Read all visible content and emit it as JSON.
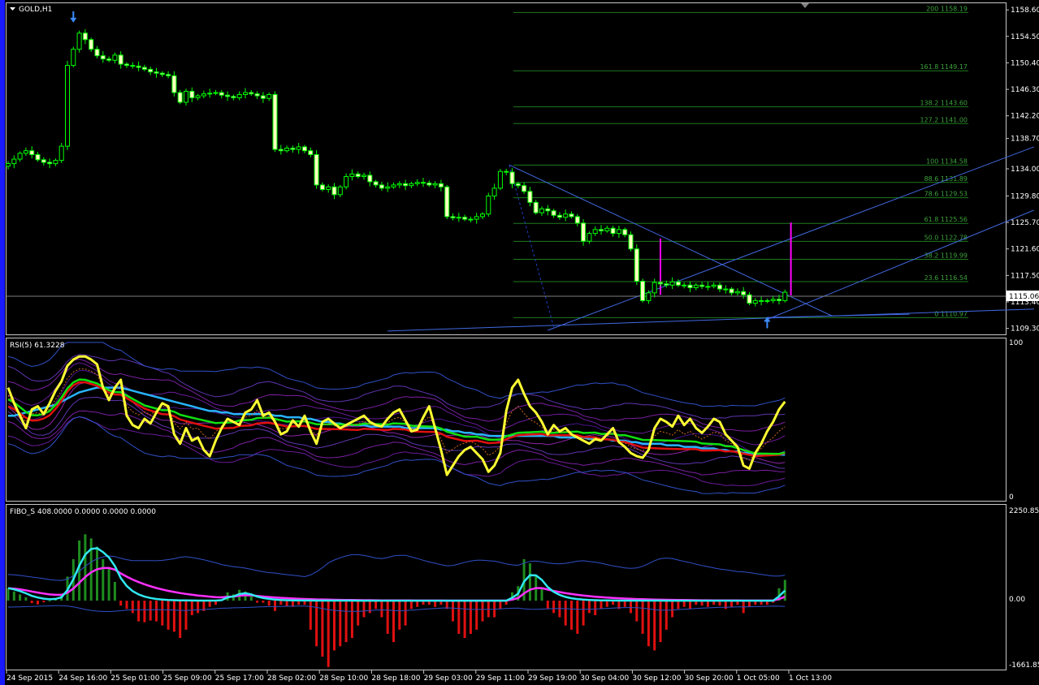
{
  "main": {
    "title": "GOLD,H1",
    "price_axis": [
      "1158.60",
      "1154.50",
      "1150.40",
      "1146.30",
      "1142.20",
      "1138.70",
      "1134.00",
      "1129.80",
      "1125.70",
      "1121.60",
      "1117.50",
      "1113.40",
      "1109.30"
    ],
    "current_price": "1115.06",
    "fib_levels": [
      {
        "label": "200 1158.19",
        "price": 1158.19
      },
      {
        "label": "161.8 1149.17",
        "price": 1149.17
      },
      {
        "label": "138.2 1143.60",
        "price": 1143.6
      },
      {
        "label": "127.2 1141.00",
        "price": 1141.0
      },
      {
        "label": "100 1134.58",
        "price": 1134.58
      },
      {
        "label": "88.6 1131.89",
        "price": 1131.89
      },
      {
        "label": "78.6 1129.53",
        "price": 1129.53
      },
      {
        "label": "61.8 1125.56",
        "price": 1125.56
      },
      {
        "label": "50.0 1122.78",
        "price": 1122.78
      },
      {
        "label": "38.2 1119.99",
        "price": 1119.99
      },
      {
        "label": "23.6 1116.54",
        "price": 1116.54
      },
      {
        "label": "0 1110.97",
        "price": 1110.97
      }
    ]
  },
  "rsi": {
    "title": "RSI(5) 61.3228",
    "axis": [
      "100",
      "0"
    ]
  },
  "fibo": {
    "title": "FIBO_S 408.0000 0.0000 0.0000 0.0000",
    "axis": [
      "2250.85",
      "0.00",
      "-1661.85"
    ]
  },
  "time_axis": [
    "24 Sep 2015",
    "24 Sep 16:00",
    "25 Sep 01:00",
    "25 Sep 09:00",
    "25 Sep 17:00",
    "28 Sep 02:00",
    "28 Sep 10:00",
    "28 Sep 18:00",
    "29 Sep 03:00",
    "29 Sep 11:00",
    "29 Sep 19:00",
    "30 Sep 04:00",
    "30 Sep 12:00",
    "30 Sep 20:00",
    "1 Oct 05:00",
    "1 Oct 13:00"
  ],
  "chart_data": [
    {
      "type": "candlestick",
      "title": "GOLD,H1",
      "ylim": [
        1108.5,
        1159.5
      ],
      "bars": 132,
      "close_approx": [
        1134.8,
        1135.5,
        1136.4,
        1136.8,
        1136.2,
        1135.4,
        1135.0,
        1134.8,
        1135.3,
        1137.5,
        1150.0,
        1152.5,
        1155.0,
        1154.0,
        1152.5,
        1151.5,
        1151.0,
        1150.8,
        1151.6,
        1150.2,
        1150.0,
        1149.9,
        1149.7,
        1149.4,
        1149.0,
        1148.8,
        1148.6,
        1148.4,
        1145.8,
        1144.3,
        1146.0,
        1145.0,
        1145.3,
        1145.6,
        1145.7,
        1145.8,
        1145.4,
        1145.2,
        1145.0,
        1145.5,
        1145.8,
        1145.6,
        1145.3,
        1144.9,
        1145.5,
        1137.0,
        1136.8,
        1137.2,
        1137.0,
        1137.4,
        1136.8,
        1136.2,
        1131.5,
        1130.8,
        1131.2,
        1130.0,
        1131.2,
        1132.8,
        1133.2,
        1132.8,
        1133.0,
        1132.0,
        1131.5,
        1131.0,
        1131.2,
        1131.5,
        1131.7,
        1131.4,
        1131.7,
        1131.9,
        1131.8,
        1131.5,
        1131.7,
        1131.2,
        1126.6,
        1126.4,
        1126.5,
        1126.2,
        1126.2,
        1126.6,
        1127.0,
        1129.8,
        1131.0,
        1133.6,
        1133.5,
        1131.7,
        1131.4,
        1130.5,
        1128.8,
        1127.2,
        1127.8,
        1127.5,
        1126.8,
        1126.5,
        1127.0,
        1126.6,
        1125.6,
        1122.8,
        1124.0,
        1124.6,
        1124.4,
        1124.8,
        1124.0,
        1124.6,
        1123.8,
        1121.6,
        1116.6,
        1113.6,
        1114.8,
        1116.4,
        1116.2,
        1116.0,
        1116.5,
        1116.0,
        1116.0,
        1115.6,
        1116.0,
        1115.8,
        1115.8,
        1116.0,
        1115.4,
        1115.4,
        1114.8,
        1115.0,
        1114.5,
        1113.2,
        1113.6,
        1113.6,
        1113.6,
        1113.8,
        1113.6,
        1114.9
      ]
    },
    {
      "type": "line",
      "title": "RSI(5) 61.3228",
      "ylim": [
        0,
        100
      ],
      "series": [
        {
          "values": [
            70,
            60,
            52,
            44,
            56,
            58,
            53,
            60,
            68,
            74,
            84,
            88,
            90,
            90,
            88,
            85,
            70,
            62,
            70,
            75,
            52,
            46,
            44,
            50,
            47,
            54,
            60,
            58,
            40,
            34,
            44,
            36,
            38,
            30,
            26,
            36,
            44,
            50,
            48,
            46,
            54,
            56,
            62,
            52,
            54,
            48,
            40,
            42,
            49,
            45,
            52,
            42,
            34,
            48,
            50,
            47,
            44,
            46,
            48,
            50,
            52,
            48,
            46,
            45,
            50,
            54,
            56,
            49,
            42,
            43,
            51,
            58,
            44,
            30,
            14,
            20,
            26,
            30,
            32,
            28,
            24,
            16,
            20,
            28,
            55,
            70,
            75,
            66,
            58,
            54,
            48,
            40,
            46,
            42,
            44,
            40,
            38,
            36,
            34,
            37,
            36,
            40,
            44,
            35,
            32,
            28,
            26,
            25,
            30,
            44,
            50,
            48,
            45,
            52,
            46,
            50,
            44,
            41,
            45,
            50,
            48,
            40,
            36,
            32,
            20,
            18,
            28,
            34,
            42,
            48,
            56,
            61
          ]
        },
        {
          "values": [
            60,
            58,
            55,
            52,
            50,
            50,
            51,
            53,
            57,
            62,
            68,
            72,
            74,
            74,
            73,
            72,
            70,
            68,
            67,
            67,
            65,
            63,
            61,
            59,
            58,
            57,
            56,
            56,
            55,
            53,
            52,
            51,
            50,
            49,
            48,
            47,
            47,
            47,
            47,
            48,
            48,
            48,
            49,
            49,
            49,
            48,
            47,
            46,
            46,
            46,
            46,
            45,
            44,
            44,
            44,
            44,
            44,
            44,
            44,
            44,
            45,
            45,
            45,
            45,
            45,
            46,
            46,
            46,
            45,
            45,
            45,
            45,
            45,
            44,
            42,
            41,
            40,
            39,
            39,
            39,
            38,
            37,
            37,
            37,
            39,
            40,
            41,
            41,
            41,
            41,
            41,
            40,
            40,
            40,
            40,
            40,
            40,
            39,
            39,
            39,
            38,
            38,
            38,
            37,
            37,
            36,
            35,
            34,
            34,
            34,
            34,
            34,
            34,
            34,
            34,
            34,
            34,
            33,
            33,
            33,
            33,
            32,
            32,
            31,
            30,
            29,
            28,
            28,
            28,
            28,
            28,
            29
          ]
        },
        {
          "values": [
            52,
            52,
            53,
            54,
            55,
            56,
            57,
            58,
            59,
            61,
            63,
            65,
            67,
            68,
            69,
            70,
            70,
            70,
            70,
            70,
            69,
            68,
            67,
            66,
            65,
            64,
            63,
            62,
            61,
            60,
            59,
            58,
            57,
            56,
            55,
            55,
            54,
            54,
            53,
            53,
            53,
            53,
            53,
            53,
            53,
            52,
            52,
            51,
            51,
            51,
            50,
            50,
            49,
            48,
            48,
            47,
            47,
            46,
            46,
            46,
            46,
            45,
            45,
            45,
            45,
            45,
            45,
            44,
            44,
            44,
            44,
            44,
            44,
            43,
            43,
            42,
            42,
            41,
            41,
            40,
            40,
            39,
            39,
            39,
            39,
            39,
            39,
            39,
            39,
            39,
            39,
            39,
            39,
            38,
            38,
            38,
            38,
            38,
            37,
            37,
            37,
            37,
            36,
            36,
            36,
            35,
            35,
            34,
            34,
            34,
            34,
            33,
            33,
            33,
            32,
            32,
            32,
            31,
            31,
            31,
            30,
            30,
            29,
            29,
            28,
            28,
            27,
            27,
            27,
            27,
            27,
            27
          ]
        }
      ]
    },
    {
      "type": "bar",
      "title": "FIBO_S 408.0000 0.0000 0.0000 0.0000",
      "ylim": [
        -1661.85,
        2250.85
      ],
      "values": [
        300,
        220,
        150,
        80,
        -60,
        -90,
        -40,
        0,
        60,
        150,
        580,
        1000,
        1450,
        1600,
        1500,
        1300,
        1000,
        800,
        450,
        -120,
        -200,
        -300,
        -500,
        -520,
        -480,
        -500,
        -600,
        -700,
        -750,
        -900,
        -700,
        -350,
        -300,
        -250,
        -150,
        -100,
        30,
        200,
        150,
        260,
        220,
        100,
        -50,
        -50,
        -120,
        -250,
        -100,
        -130,
        -150,
        -100,
        -100,
        -700,
        -1100,
        -1350,
        -1600,
        -1200,
        -1100,
        -1000,
        -900,
        -600,
        -400,
        -300,
        -200,
        -400,
        -800,
        -1000,
        -700,
        -600,
        -200,
        -150,
        -100,
        -100,
        -150,
        -100,
        -200,
        -500,
        -800,
        -900,
        -800,
        -700,
        -500,
        -400,
        -400,
        -200,
        -100,
        200,
        350,
        1000,
        900,
        600,
        300,
        -200,
        -300,
        -400,
        -600,
        -700,
        -800,
        -600,
        -300,
        -350,
        -200,
        -150,
        -100,
        -200,
        -150,
        -300,
        -500,
        -800,
        -1100,
        -1200,
        -1000,
        -700,
        -400,
        -200,
        -150,
        -200,
        -100,
        -120,
        -150,
        -100,
        -120,
        -200,
        -150,
        -100,
        -300,
        -150,
        -100,
        -100,
        -100,
        -50,
        300,
        500
      ]
    }
  ]
}
